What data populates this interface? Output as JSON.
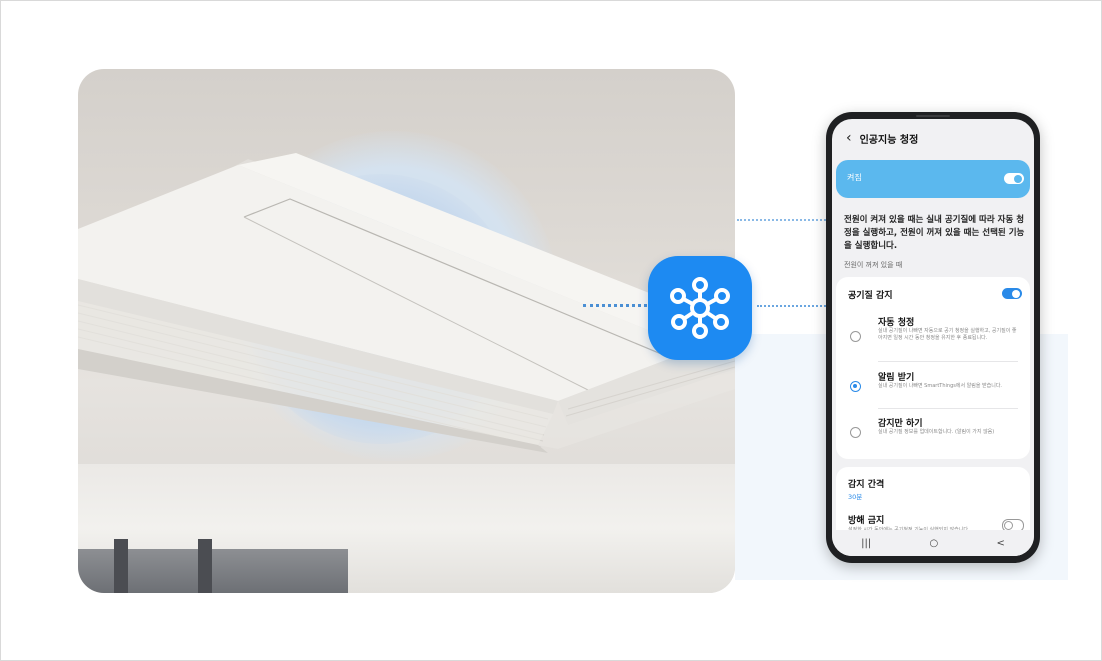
{
  "colors": {
    "brand_blue": "#1d8af2",
    "header_bar": "#5bb8ee",
    "toggle_on": "#2a8ae8"
  },
  "app": {
    "back_icon": "chevron-left-icon",
    "title": "인공지능 청정",
    "power_label": "켜짐",
    "description": "전원이 켜져 있을 때는 실내 공기질에 따라 자동 청정을 실행하고, 전원이 꺼져 있을 때는 선택된 기능을 실행합니다.",
    "section_label": "전원이 꺼져 있을 때",
    "air_quality_detect": "공기질 감지",
    "options": [
      {
        "title": "자동 청정",
        "desc": "실내 공기질이 나빠면 자동으로 공기 청정을 실행하고, 공기질이 좋아지면 일정 시간 동안 청정을 유지한 후 종료됩니다.",
        "selected": false
      },
      {
        "title": "알림 받기",
        "desc": "실내 공기질이 나빠면 SmartThings에서 알림을 받습니다.",
        "selected": true
      },
      {
        "title": "감지만 하기",
        "desc": "실내 공기질 정보를 업데이트합니다. (알림이 가지 않음)",
        "selected": false
      }
    ],
    "interval_label": "감지 간격",
    "interval_value": "30분",
    "dnd_label": "방해 금지",
    "dnd_desc": "설정한 시간 동안에는 공기청정 기능이 실행되지 않습니다.",
    "nav": {
      "recent": "|||",
      "home": "○",
      "back": "<"
    }
  },
  "smartthings_icon": "smartthings-icon"
}
